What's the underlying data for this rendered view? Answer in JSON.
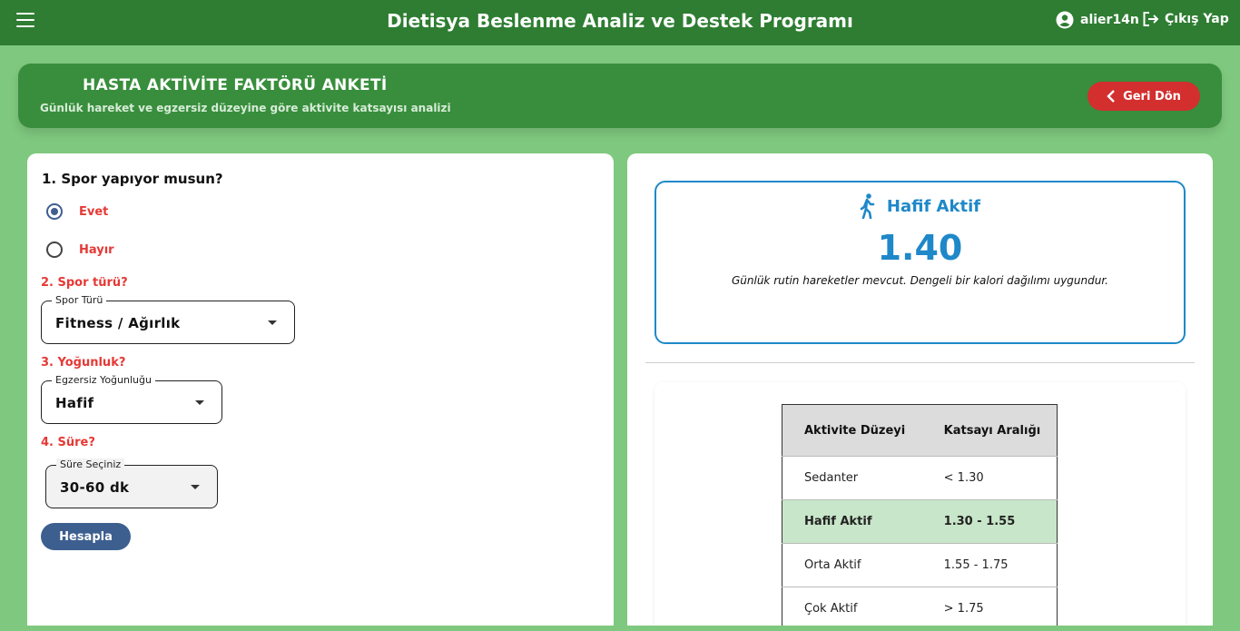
{
  "appbar": {
    "title": "Dietisya Beslenme Analiz ve Destek Programı",
    "username": "alier14n",
    "logout_label": "Çıkış Yap"
  },
  "banner": {
    "title": "HASTA AKTİVİTE FAKTÖRÜ ANKETİ",
    "subtitle": "Günlük hareket ve egzersiz düzeyine göre aktivite katsayısı analizi",
    "back_label": "Geri Dön"
  },
  "form": {
    "q1": "1. Spor yapıyor musun?",
    "option_yes": "Evet",
    "option_no": "Hayır",
    "selected": "Evet",
    "q2": "2. Spor türü?",
    "sport_type": {
      "legend": "Spor Türü",
      "value": "Fitness / Ağırlık"
    },
    "q3": "3. Yoğunluk?",
    "intensity": {
      "legend": "Egzersiz Yoğunluğu",
      "value": "Hafif"
    },
    "q4": "4. Süre?",
    "duration": {
      "legend": "Süre Seçiniz",
      "value": "30-60 dk"
    },
    "calculate_label": "Hesapla"
  },
  "result": {
    "level": "Hafif Aktif",
    "value": "1.40",
    "description": "Günlük rutin hareketler mevcut. Dengeli bir kalori dağılımı uygundur."
  },
  "table": {
    "headers": [
      "Aktivite Düzeyi",
      "Katsayı Aralığı"
    ],
    "rows": [
      [
        "Sedanter",
        "< 1.30"
      ],
      [
        "Hafif Aktif",
        "1.30 - 1.55"
      ],
      [
        "Orta Aktif",
        "1.55 - 1.75"
      ],
      [
        "Çok Aktif",
        "> 1.75"
      ]
    ],
    "highlighted_row": "Hafif Aktif"
  },
  "colors": {
    "appbar": "#2e7d32",
    "banner": "#388e3c",
    "background": "#7fc87f",
    "accent_blue": "#1f88c9",
    "danger": "#d32f2f",
    "button_blue": "#3d5f8f",
    "highlight_row": "#c8e6c9"
  },
  "icons": {
    "menu": "menu-icon",
    "user": "account-circle-icon",
    "logout": "logout-icon",
    "back": "chevron-left-icon",
    "walk": "walking-person-icon"
  }
}
